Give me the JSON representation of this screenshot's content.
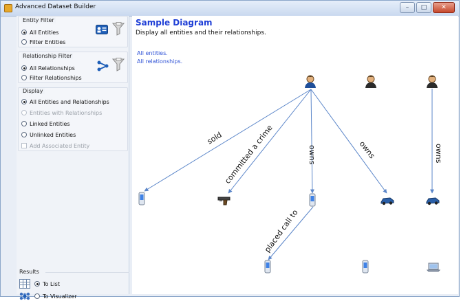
{
  "window": {
    "title": "Advanced Dataset Builder",
    "controls": [
      "–",
      "□",
      "✕"
    ]
  },
  "left_panel": {
    "entity_filter": {
      "title": "Entity Filter",
      "options": [
        {
          "label": "All Entities",
          "selected": true
        },
        {
          "label": "Filter Entities",
          "selected": false
        }
      ]
    },
    "relationship_filter": {
      "title": "Relationship Filter",
      "options": [
        {
          "label": "All Relationships",
          "selected": true
        },
        {
          "label": "Filter Relationships",
          "selected": false
        }
      ]
    },
    "display": {
      "title": "Display",
      "options": [
        {
          "label": "All Entities and Relationships",
          "selected": true,
          "enabled": true
        },
        {
          "label": "Entities with Relationships",
          "selected": false,
          "enabled": false
        },
        {
          "label": "Linked Entities",
          "selected": false,
          "enabled": true
        },
        {
          "label": "Unlinked Entities",
          "selected": false,
          "enabled": true
        }
      ],
      "checkbox": {
        "label": "Add Associated Entity",
        "checked": false,
        "enabled": false
      }
    },
    "results": {
      "title": "Results",
      "options": [
        {
          "label": "To List",
          "selected": true
        },
        {
          "label": "To Visualizer",
          "selected": false
        }
      ]
    }
  },
  "diagram": {
    "title": "Sample Diagram",
    "description": "Display all entities and their relationships.",
    "filters": [
      "All entities.",
      "All relationships."
    ],
    "edge_labels": [
      "sold",
      "committed a crime",
      "owns",
      "owns",
      "owns",
      "placed call to"
    ]
  },
  "colors": {
    "title_blue": "#1f3fd6",
    "link_blue": "#2f52d6",
    "edge": "#5b86c9"
  }
}
